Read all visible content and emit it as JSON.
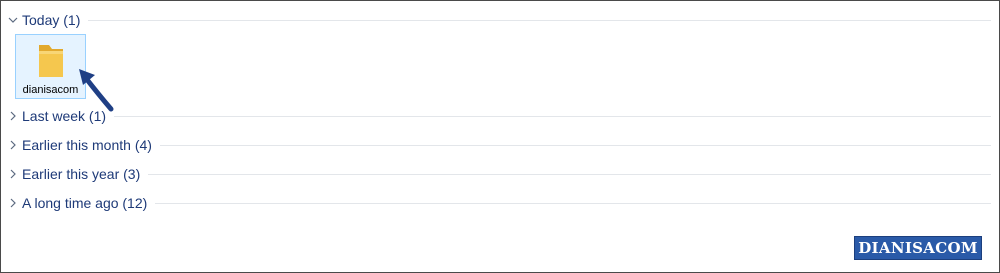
{
  "groups": [
    {
      "label": "Today (1)",
      "expanded": true
    },
    {
      "label": "Last week (1)",
      "expanded": false
    },
    {
      "label": "Earlier this month (4)",
      "expanded": false
    },
    {
      "label": "Earlier this year (3)",
      "expanded": false
    },
    {
      "label": "A long time ago (12)",
      "expanded": false
    }
  ],
  "today_items": [
    {
      "name": "dianisacom",
      "icon": "folder-icon",
      "selected": true
    }
  ],
  "watermark": {
    "text": "DIANISACOM"
  },
  "colors": {
    "group_text": "#1e3a78",
    "selection_fill": "#e5f3ff",
    "selection_border": "#99d1ff",
    "folder": "#f5c74e",
    "annotation_arrow": "#1f3f85",
    "watermark_bg": "#2a5aa8"
  }
}
